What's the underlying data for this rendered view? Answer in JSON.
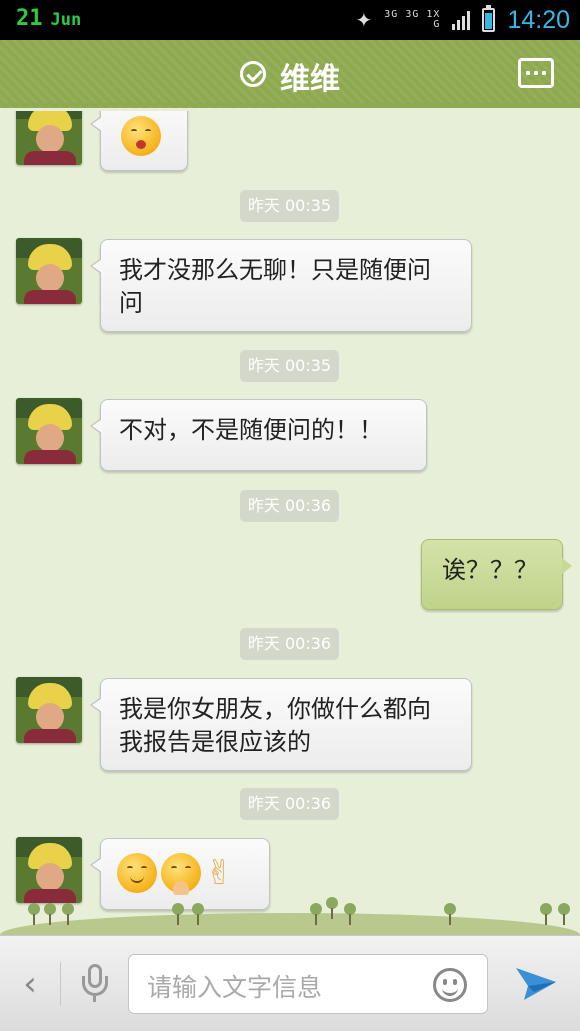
{
  "status_bar": {
    "day": "21",
    "month": "Jun",
    "network_top": "3G 3G 1X",
    "network_bottom": "G",
    "time": "14:20"
  },
  "header": {
    "title": "维维",
    "menu_icon": "more-dots-icon",
    "verified_icon": "check-circle-icon"
  },
  "messages": [
    {
      "type": "incoming",
      "content": "emoji",
      "emoji": [
        "angry-face"
      ]
    },
    {
      "type": "timestamp",
      "text": "昨天 00:35"
    },
    {
      "type": "incoming",
      "text": "我才没那么无聊！只是随便问问"
    },
    {
      "type": "timestamp",
      "text": "昨天 00:35"
    },
    {
      "type": "incoming",
      "text": "不对，不是随便问的！！"
    },
    {
      "type": "timestamp",
      "text": "昨天 00:36"
    },
    {
      "type": "outgoing",
      "text": "诶？？？"
    },
    {
      "type": "timestamp",
      "text": "昨天 00:36"
    },
    {
      "type": "incoming",
      "text": "我是你女朋友，你做什么都向我报告是很应该的"
    },
    {
      "type": "timestamp",
      "text": "昨天 00:36"
    },
    {
      "type": "incoming",
      "content": "emoji",
      "emoji": [
        "smile",
        "blush-hands",
        "victory-hand"
      ]
    }
  ],
  "input_bar": {
    "placeholder": "请输入文字信息",
    "back_icon": "chevron-left-icon",
    "voice_icon": "microphone-icon",
    "emoji_icon": "smiley-icon",
    "send_icon": "paper-plane-icon"
  },
  "colors": {
    "header": "#8ea94f",
    "background": "#e7efd8",
    "outgoing_bubble": "#c7d996",
    "time_accent": "#35b7ea"
  }
}
